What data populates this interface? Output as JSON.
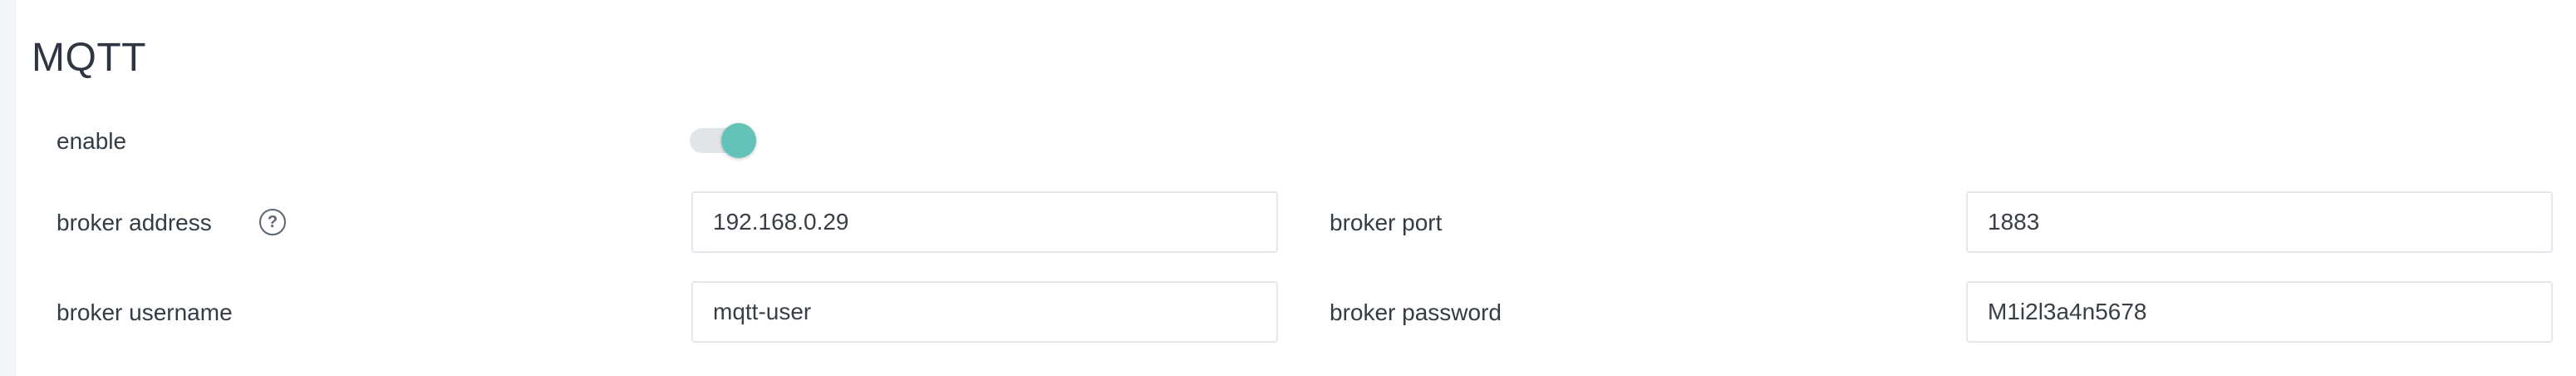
{
  "section": {
    "title": "MQTT"
  },
  "fields": {
    "enable": {
      "label": "enable",
      "value": true,
      "accent_color": "#63c3b8"
    },
    "broker_address": {
      "label": "broker address",
      "value": "192.168.0.29",
      "help_icon": "?"
    },
    "broker_port": {
      "label": "broker port",
      "value": "1883"
    },
    "broker_username": {
      "label": "broker username",
      "value": "mqtt-user"
    },
    "broker_password": {
      "label": "broker password",
      "value": "M1i2l3a4n5678"
    }
  }
}
